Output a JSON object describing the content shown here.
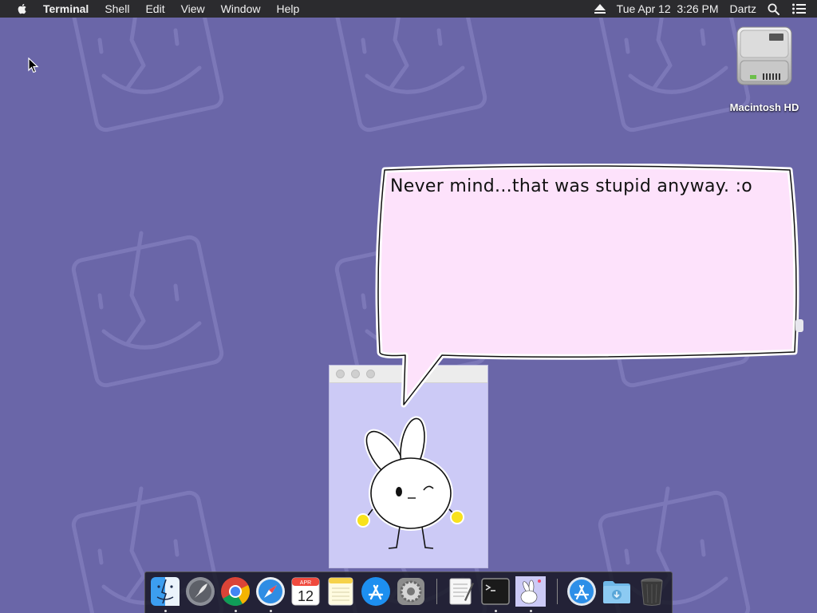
{
  "menubar": {
    "app_name": "Terminal",
    "menus": [
      "Shell",
      "Edit",
      "View",
      "Window",
      "Help"
    ],
    "datetime": "Tue Apr 12  3:26 PM",
    "user": "Dartz"
  },
  "desktop": {
    "icons": [
      {
        "label": "Macintosh HD",
        "icon": "hard-drive-icon"
      }
    ]
  },
  "bubble": {
    "text": "Never mind...that was stupid anyway. :o"
  },
  "dock": {
    "calendar_month": "APR",
    "calendar_day": "12",
    "apps": [
      "finder",
      "launchpad",
      "chrome",
      "safari",
      "calendar",
      "notes",
      "app-store",
      "system-preferences",
      "textedit",
      "terminal",
      "bunny-app",
      "app-store-2",
      "downloads-folder",
      "trash"
    ]
  },
  "colors": {
    "desktop": "#6a66a8",
    "bubble_fill": "#fde2fb",
    "window_fill": "#cccaf6",
    "accent_yellow": "#f8e21c"
  }
}
